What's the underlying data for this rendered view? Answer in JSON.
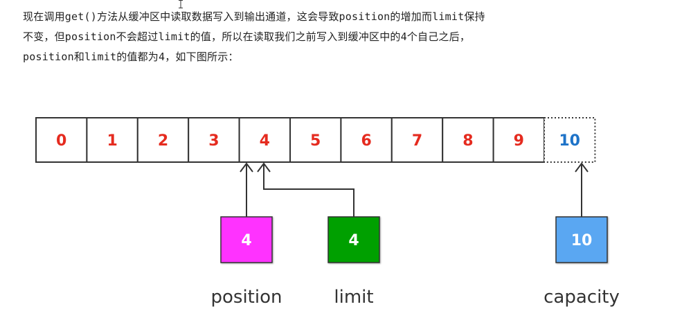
{
  "paragraph": {
    "lines": [
      "现在调用get()方法从缓冲区中读取数据写入到输出通道，这会导致position的增加而limit保持",
      "不变，但position不会超过limit的值，所以在读取我们之前写入到缓冲区中的4个自己之后，",
      "position和limit的值都为4，如下图所示："
    ]
  },
  "buffer": {
    "cells": [
      "0",
      "1",
      "2",
      "3",
      "4",
      "5",
      "6",
      "7",
      "8",
      "9"
    ],
    "extra_cell": "10",
    "cell_color": "#e52b1f",
    "extra_cell_color": "#1e73c8"
  },
  "markers": [
    {
      "value": "4",
      "label": "position",
      "color": "#ff33ff",
      "points_to": 4
    },
    {
      "value": "4",
      "label": "limit",
      "color": "#00a000",
      "points_to": 4
    },
    {
      "value": "10",
      "label": "capacity",
      "color": "#5aa7f2",
      "points_to": 10
    }
  ]
}
